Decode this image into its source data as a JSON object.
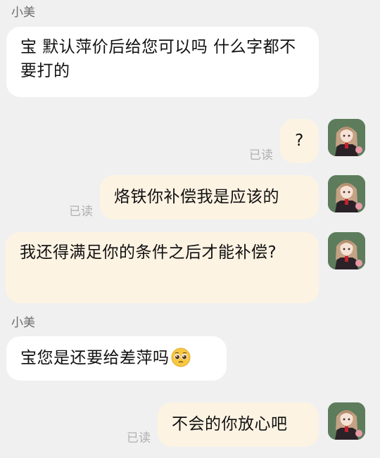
{
  "messages": [
    {
      "sender": "小美",
      "text": "宝 默认萍价后给您可以吗  什么字都不要打的"
    },
    {
      "text": "?",
      "status": "已读"
    },
    {
      "text": "烙铁你补偿我是应该的",
      "status": "已读"
    },
    {
      "text": "我还得满足你的条件之后才能补偿?"
    },
    {
      "sender": "小美",
      "text": "宝您是还要给差萍吗"
    },
    {
      "text": "不会的你放心吧",
      "status": "已读"
    }
  ],
  "icons": {
    "pleading_emoji": "pleading-face-emoji",
    "avatar": "anime-girl-avatar"
  }
}
